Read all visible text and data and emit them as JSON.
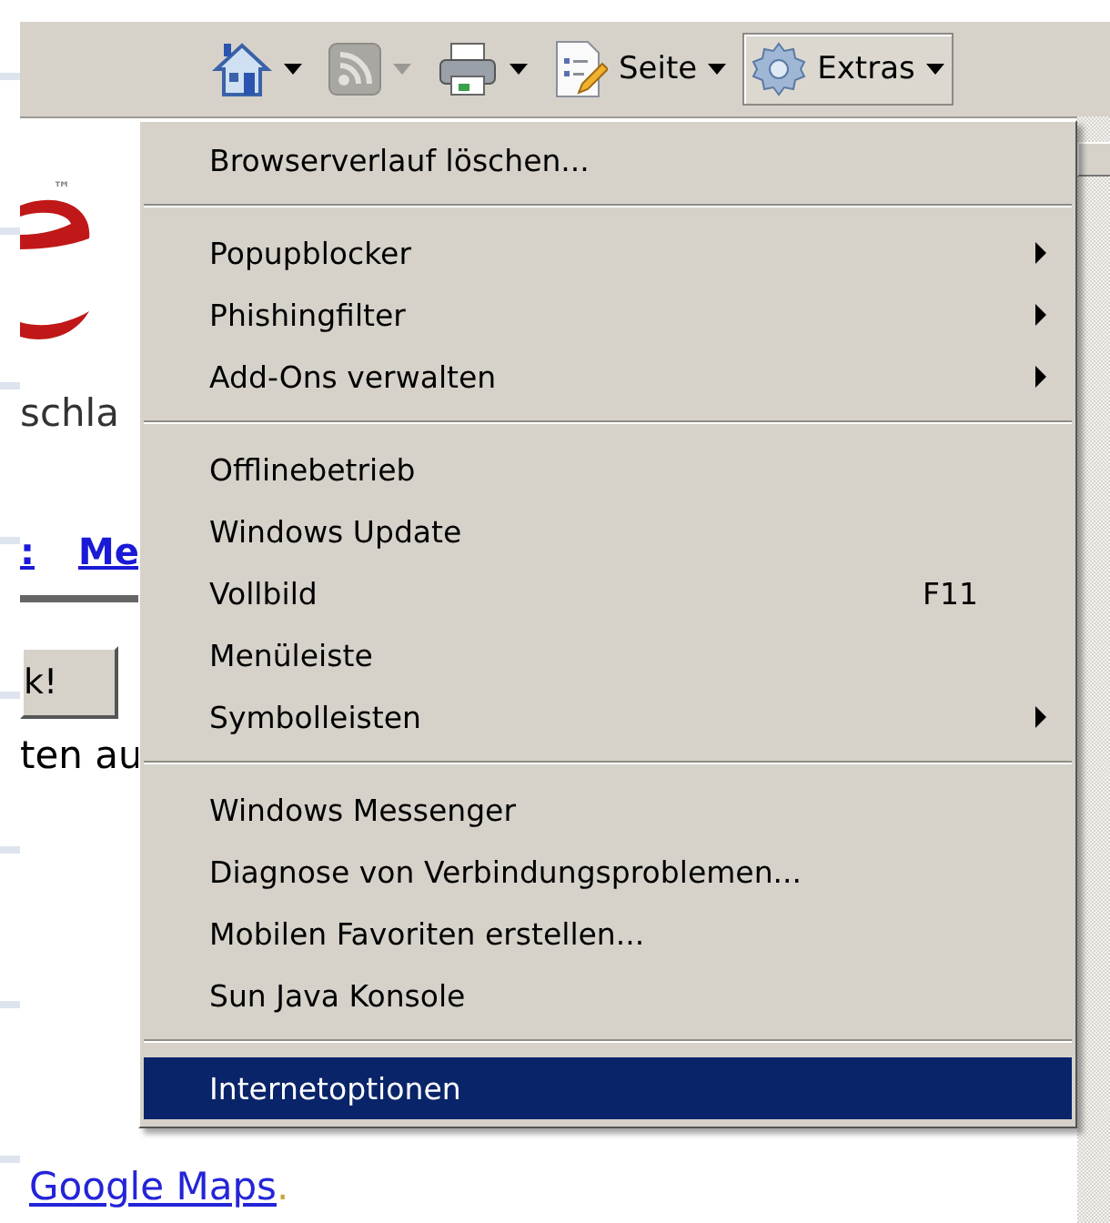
{
  "toolbar": {
    "buttons": [
      {
        "kind": "home",
        "disabled": false,
        "selected": false
      },
      {
        "kind": "feed",
        "disabled": true,
        "selected": false
      },
      {
        "kind": "print",
        "disabled": false,
        "selected": false
      },
      {
        "kind": "page",
        "label": "Seite",
        "disabled": false,
        "selected": false
      },
      {
        "kind": "tools",
        "label": "Extras",
        "disabled": false,
        "selected": true
      }
    ]
  },
  "page": {
    "trademark": "™",
    "slogan_fragment": "schla",
    "link_fragment_1": ":",
    "link_fragment_2": "Me",
    "button_fragment": "k!",
    "text_fragment": "ten au",
    "maps_link": "Google Maps",
    "maps_suffix": "."
  },
  "menu": {
    "sections": [
      [
        {
          "label": "Browserverlauf löschen...",
          "submenu": false,
          "selected": false
        }
      ],
      [
        {
          "label": "Popupblocker",
          "submenu": true,
          "selected": false
        },
        {
          "label": "Phishingfilter",
          "submenu": true,
          "selected": false
        },
        {
          "label": "Add-Ons verwalten",
          "submenu": true,
          "selected": false
        }
      ],
      [
        {
          "label": "Offlinebetrieb",
          "submenu": false,
          "selected": false
        },
        {
          "label": "Windows Update",
          "submenu": false,
          "selected": false
        },
        {
          "label": "Vollbild",
          "shortcut": "F11",
          "submenu": false,
          "selected": false
        },
        {
          "label": "Menüleiste",
          "submenu": false,
          "selected": false
        },
        {
          "label": "Symbolleisten",
          "submenu": true,
          "selected": false
        }
      ],
      [
        {
          "label": "Windows Messenger",
          "submenu": false,
          "selected": false
        },
        {
          "label": "Diagnose von Verbindungsproblemen...",
          "submenu": false,
          "selected": false
        },
        {
          "label": "Mobilen Favoriten erstellen...",
          "submenu": false,
          "selected": false
        },
        {
          "label": "Sun Java Konsole",
          "submenu": false,
          "selected": false
        }
      ],
      [
        {
          "label": "Internetoptionen",
          "submenu": false,
          "selected": true
        }
      ]
    ]
  }
}
